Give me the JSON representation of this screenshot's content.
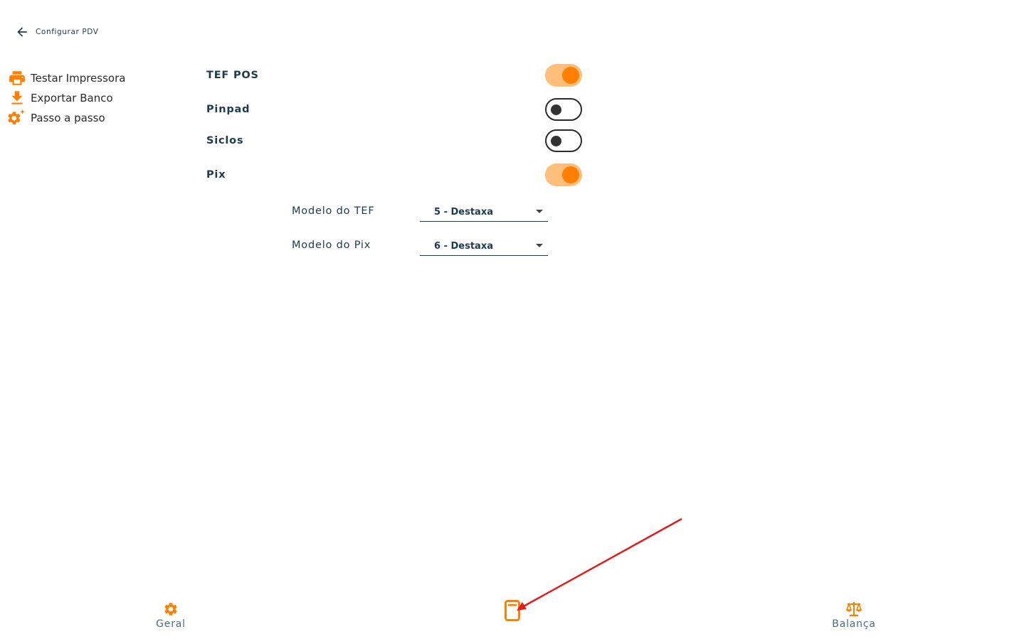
{
  "header": {
    "title": "Configurar PDV",
    "back_icon": "arrow-left-icon"
  },
  "side_menu": {
    "items": [
      {
        "label": "Testar Impressora",
        "icon": "printer-icon"
      },
      {
        "label": "Exportar Banco",
        "icon": "download-icon"
      },
      {
        "label": "Passo a passo",
        "icon": "gear-sparkle-icon"
      }
    ]
  },
  "settings": {
    "tef_pos": {
      "label": "TEF POS",
      "enabled": true
    },
    "pinpad": {
      "label": "Pinpad",
      "enabled": false
    },
    "siclos": {
      "label": "Siclos",
      "enabled": false
    },
    "pix": {
      "label": "Pix",
      "enabled": true
    }
  },
  "selects": {
    "modelo_tef": {
      "label": "Modelo do TEF",
      "value": "5 - Destaxa"
    },
    "modelo_pix": {
      "label": "Modelo do Pix",
      "value": "6 - Destaxa"
    }
  },
  "bottom_nav": {
    "geral": {
      "label": "Geral",
      "icon": "gear-icon"
    },
    "tef": {
      "label": "",
      "icon": "pos-terminal-icon"
    },
    "balanca": {
      "label": "Balança",
      "icon": "scale-icon"
    }
  },
  "colors": {
    "accent": "#ff7f00",
    "toggle_track_on": "#ffbf7a",
    "text_primary": "#1e3a4f",
    "annotation_arrow": "#e41b1b"
  }
}
